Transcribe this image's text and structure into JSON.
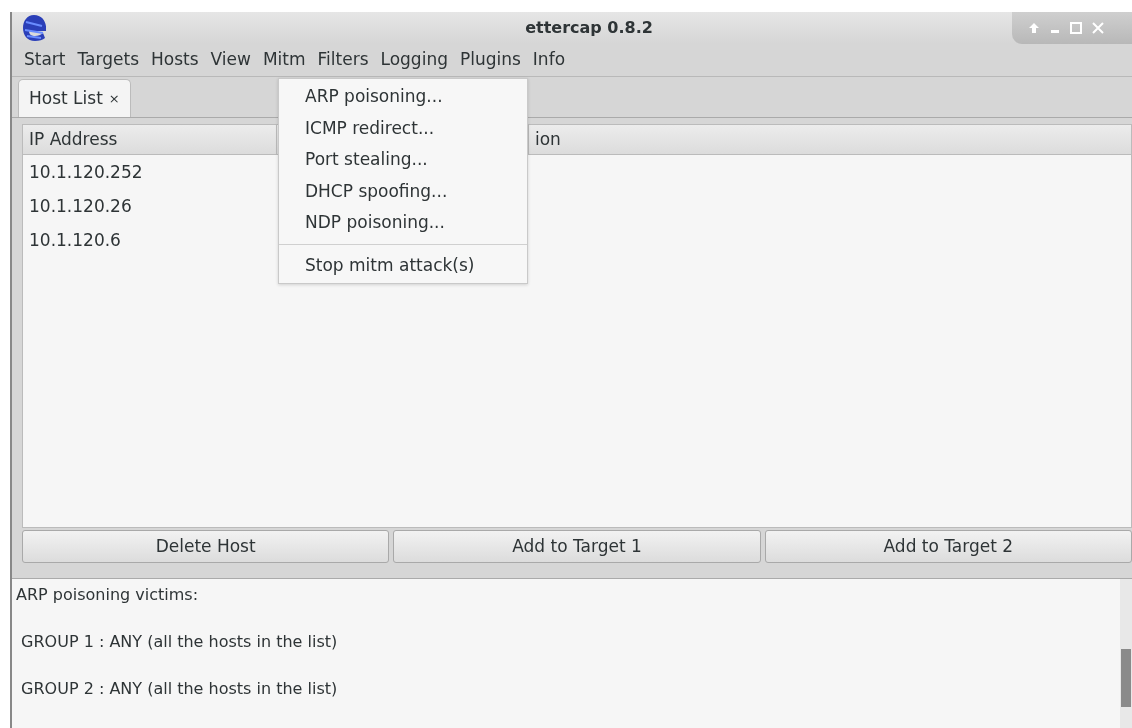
{
  "window": {
    "title": "ettercap 0.8.2"
  },
  "menu_bar": [
    "Start",
    "Targets",
    "Hosts",
    "View",
    "Mitm",
    "Filters",
    "Logging",
    "Plugins",
    "Info"
  ],
  "open_menu": {
    "items": [
      {
        "label": "ARP poisoning...",
        "kind": "item"
      },
      {
        "label": "ICMP redirect...",
        "kind": "item"
      },
      {
        "label": "Port stealing...",
        "kind": "item"
      },
      {
        "label": "DHCP spoofing...",
        "kind": "item"
      },
      {
        "label": "NDP poisoning...",
        "kind": "item"
      },
      {
        "kind": "separator"
      },
      {
        "label": "Stop mitm attack(s)",
        "kind": "item"
      }
    ]
  },
  "tabs": [
    {
      "label": "Host List",
      "close": "×",
      "selected": true
    }
  ],
  "table": {
    "columns": [
      "IP Address",
      "ion"
    ],
    "rows": [
      [
        "10.1.120.252"
      ],
      [
        "10.1.120.26"
      ],
      [
        "10.1.120.6"
      ]
    ]
  },
  "buttons": [
    "Delete Host",
    "Add to Target 1",
    "Add to Target 2"
  ],
  "log": [
    "ARP poisoning victims:",
    " GROUP 1 : ANY (all the hosts in the list)",
    " GROUP 2 : ANY (all the hosts in the list)"
  ]
}
